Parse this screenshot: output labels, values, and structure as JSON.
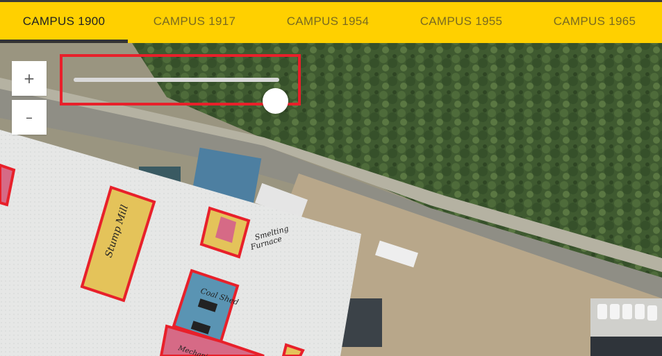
{
  "tabs": [
    {
      "label": "CAMPUS 1900",
      "active": true
    },
    {
      "label": "CAMPUS 1917",
      "active": false
    },
    {
      "label": "CAMPUS 1954",
      "active": false
    },
    {
      "label": "CAMPUS 1955",
      "active": false
    },
    {
      "label": "CAMPUS 1965",
      "active": false
    }
  ],
  "zoom": {
    "in_label": "+",
    "out_label": "–"
  },
  "opacity_slider": {
    "value": 0.98
  },
  "map_labels": {
    "mill": "Stump Mill",
    "smelting": "Smelting",
    "furnace": "Furnace",
    "coal_shed": "Coal Shed",
    "mechanic": "Mechanic"
  },
  "colors": {
    "tab_bar": "#ffd000",
    "highlight": "#e8202a",
    "building_yellow": "#e4c35a",
    "building_pink": "#d66a86",
    "building_blue": "#5a94b3",
    "paper": "#e9eaea"
  }
}
